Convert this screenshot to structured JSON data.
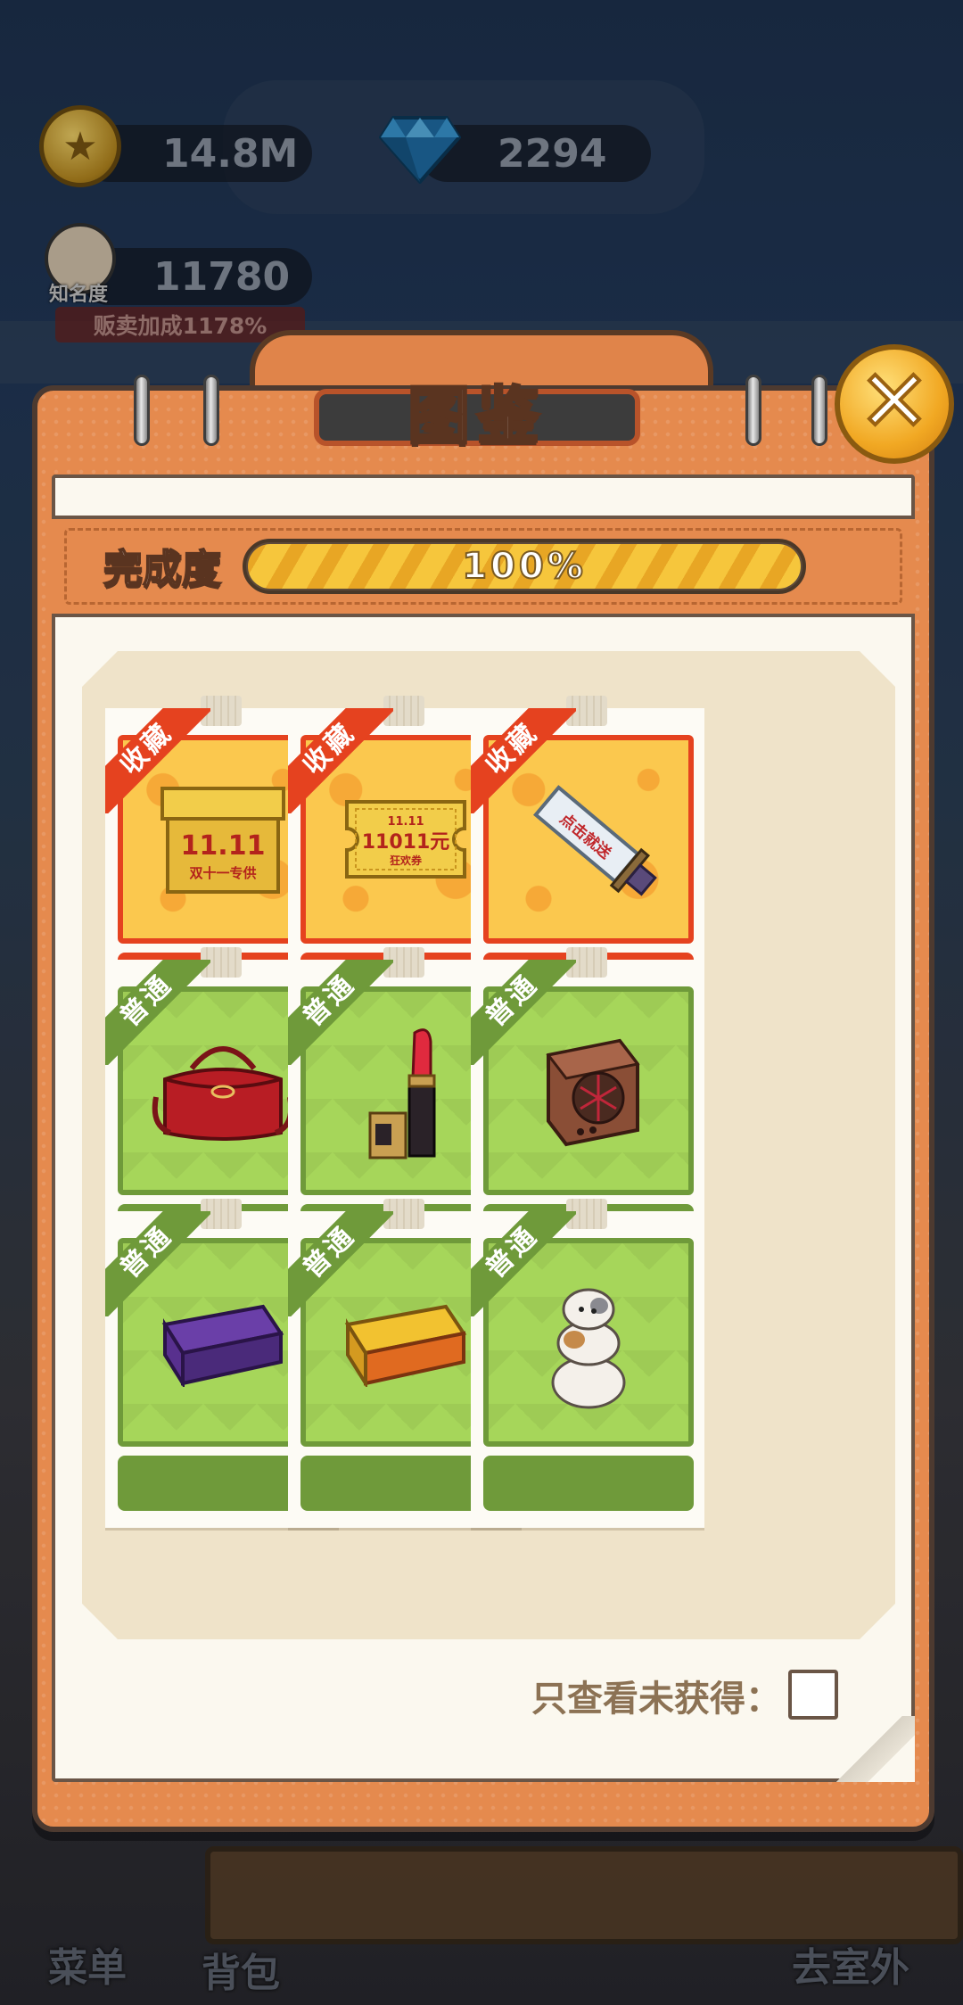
{
  "hud": {
    "coins": "14.8M",
    "gems": "2294",
    "fame": "11780",
    "fame_label": "知名度",
    "sale_bonus": "贩卖加成1178%"
  },
  "panel": {
    "title": "图鉴",
    "completion_label": "完成度",
    "completion_text": "100%",
    "completion_fraction": 1.0
  },
  "rarity": {
    "rare": "收藏",
    "common": "普通"
  },
  "items": [
    {
      "name": "金色传说箱",
      "rarity": "rare",
      "art": "golden-box-icon"
    },
    {
      "name": "双十一狂欢券",
      "rarity": "rare",
      "art": "coupon-icon"
    },
    {
      "name": "屠龙宝刀",
      "rarity": "rare",
      "art": "saber-icon"
    },
    {
      "name": "女士包",
      "rarity": "common",
      "art": "handbag-icon"
    },
    {
      "name": "口红",
      "rarity": "common",
      "art": "lipstick-icon"
    },
    {
      "name": "小音箱",
      "rarity": "common",
      "art": "speaker-icon"
    },
    {
      "name": "",
      "rarity": "common",
      "art": "purple-book-icon"
    },
    {
      "name": "",
      "rarity": "common",
      "art": "yellow-book-icon"
    },
    {
      "name": "",
      "rarity": "common",
      "art": "hamster-stack-icon"
    }
  ],
  "item_art_text": {
    "box_big": "11.11",
    "box_small": "双十一专供",
    "coupon_top": "11.11",
    "coupon_value": "11011元",
    "coupon_bottom": "狂欢券",
    "saber": "点击就送"
  },
  "filter": {
    "label": "只查看未获得："
  },
  "bottom": {
    "menu": "菜单",
    "bag": "背包",
    "outdoor": "去室外"
  }
}
